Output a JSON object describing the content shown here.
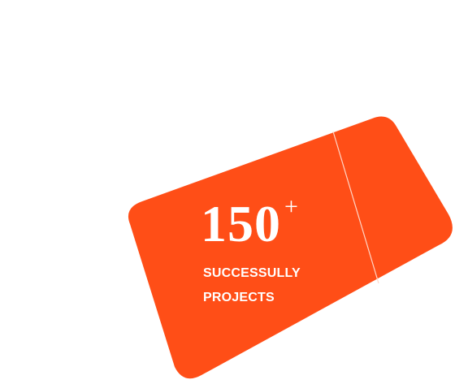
{
  "ticket": {
    "color": "#ff4e17",
    "divider_color": "#ffd7c8"
  },
  "stat": {
    "number": "150",
    "suffix": "+",
    "label_line1": "SUCCESSULLY",
    "label_line2": "PROJECTS"
  }
}
